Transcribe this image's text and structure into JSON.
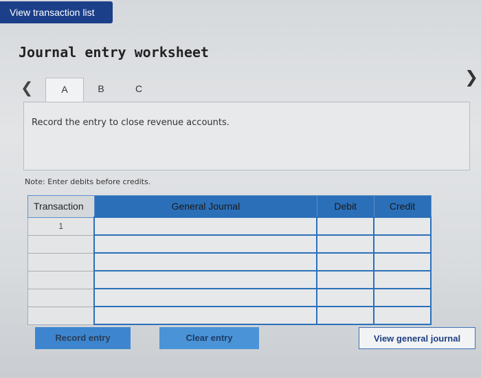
{
  "top": {
    "view_transaction_list_label": "View transaction list"
  },
  "worksheet": {
    "title": "Journal entry worksheet",
    "nav": {
      "prev_icon": "chevron-left-icon",
      "next_icon": "chevron-right-icon"
    },
    "tabs": [
      {
        "label": "A",
        "active": true
      },
      {
        "label": "B",
        "active": false
      },
      {
        "label": "C",
        "active": false
      }
    ],
    "prompt": "Record the entry to close revenue accounts.",
    "note": "Note: Enter debits before credits."
  },
  "table": {
    "columns": [
      "Transaction",
      "General Journal",
      "Debit",
      "Credit"
    ],
    "rows": [
      {
        "transaction": "1",
        "account": "",
        "debit": "",
        "credit": ""
      },
      {
        "transaction": "",
        "account": "",
        "debit": "",
        "credit": ""
      },
      {
        "transaction": "",
        "account": "",
        "debit": "",
        "credit": ""
      },
      {
        "transaction": "",
        "account": "",
        "debit": "",
        "credit": ""
      },
      {
        "transaction": "",
        "account": "",
        "debit": "",
        "credit": ""
      },
      {
        "transaction": "",
        "account": "",
        "debit": "",
        "credit": ""
      }
    ]
  },
  "buttons": {
    "record_entry": "Record entry",
    "clear_entry": "Clear entry",
    "view_general_journal": "View general journal"
  },
  "colors": {
    "primary_blue": "#1c3f8a",
    "accent_blue": "#2b6fb8"
  }
}
